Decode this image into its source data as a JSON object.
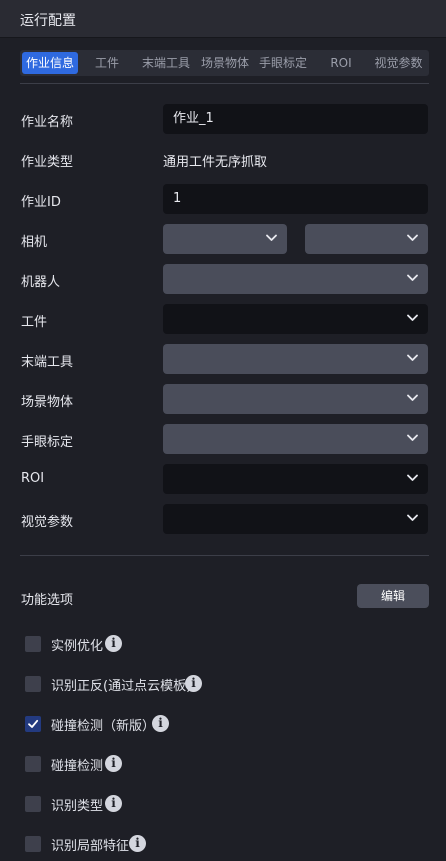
{
  "window": {
    "title": "运行配置"
  },
  "tabs": [
    {
      "label": "作业信息",
      "active": true
    },
    {
      "label": "工件",
      "active": false
    },
    {
      "label": "末端工具",
      "active": false
    },
    {
      "label": "场景物体",
      "active": false
    },
    {
      "label": "手眼标定",
      "active": false
    },
    {
      "label": "ROI",
      "active": false
    },
    {
      "label": "视觉参数",
      "active": false
    }
  ],
  "form": {
    "job_name": {
      "label": "作业名称",
      "value": "作业_1"
    },
    "job_type": {
      "label": "作业类型",
      "value": "通用工件无序抓取"
    },
    "job_id": {
      "label": "作业ID",
      "value": "1"
    },
    "camera": {
      "label": "相机",
      "value_1": "",
      "value_2": ""
    },
    "robot": {
      "label": "机器人",
      "value": ""
    },
    "workpiece": {
      "label": "工件",
      "value": ""
    },
    "end_tool": {
      "label": "末端工具",
      "value": ""
    },
    "scene_object": {
      "label": "场景物体",
      "value": ""
    },
    "hand_eye": {
      "label": "手眼标定",
      "value": ""
    },
    "roi": {
      "label": "ROI",
      "value": ""
    },
    "vision_params": {
      "label": "视觉参数",
      "value": ""
    }
  },
  "features": {
    "title": "功能选项",
    "edit_label": "编辑",
    "options": [
      {
        "label": "实例优化",
        "checked": false
      },
      {
        "label": "识别正反(通过点云模板)",
        "checked": false
      },
      {
        "label": "碰撞检测（新版）",
        "checked": true
      },
      {
        "label": "碰撞检测",
        "checked": false
      },
      {
        "label": "识别类型",
        "checked": false
      },
      {
        "label": "识别局部特征",
        "checked": false
      }
    ]
  },
  "colors": {
    "accent": "#2f6ae0",
    "background": "#1e1f26",
    "dark_field": "#111217",
    "grey_field": "#4a4d5a"
  },
  "icons": {
    "dropdown": "chevron-down-icon",
    "info": "info-icon",
    "check": "check-icon"
  }
}
